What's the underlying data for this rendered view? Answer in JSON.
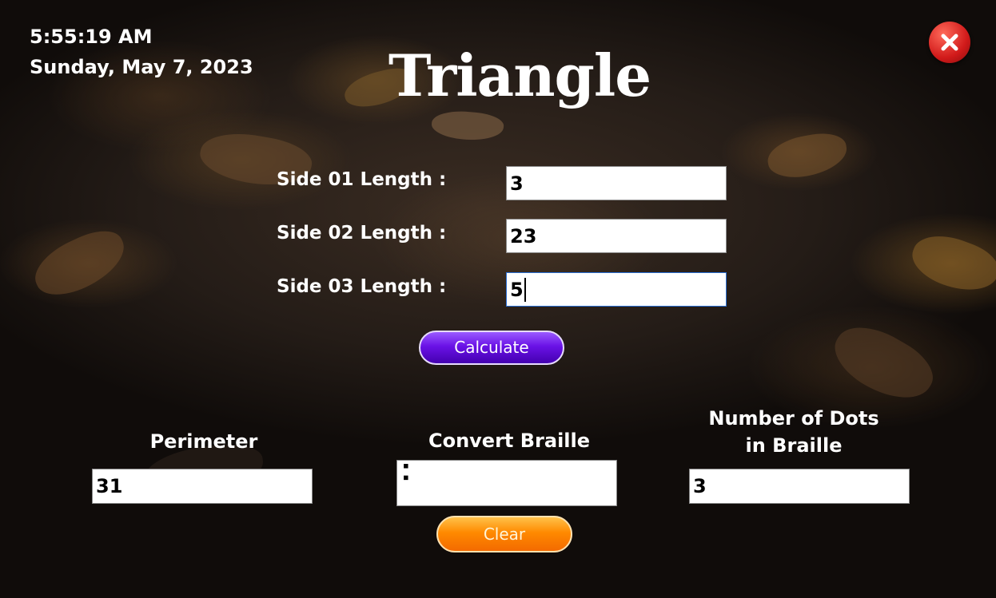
{
  "clock": {
    "time": "5:55:19 AM",
    "date": "Sunday, May 7, 2023"
  },
  "title": "Triangle",
  "inputs": {
    "side1": {
      "label": "Side 01 Length :",
      "value": "3"
    },
    "side2": {
      "label": "Side 02 Length :",
      "value": "23"
    },
    "side3": {
      "label": "Side 03 Length :",
      "value": "5"
    }
  },
  "buttons": {
    "calculate": "Calculate",
    "clear": "Clear",
    "close_icon": "close-icon"
  },
  "results": {
    "perimeter": {
      "label": "Perimeter",
      "value": "31"
    },
    "braille": {
      "label": "Convert Braille",
      "value": "⠅"
    },
    "dots": {
      "label_line1": "Number of Dots",
      "label_line2": "in Braille",
      "value": "3"
    }
  },
  "colors": {
    "calculate_button": "#6a12e6",
    "clear_button": "#ff8a00",
    "close_button": "#d11a1a"
  }
}
